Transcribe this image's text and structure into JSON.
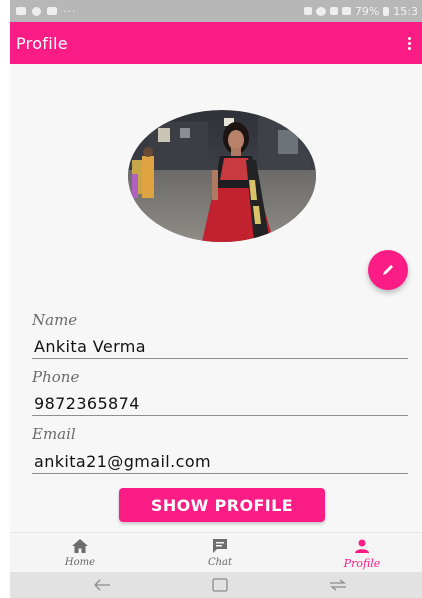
{
  "status_bar": {
    "more_dots": "···",
    "battery_percent": "79%",
    "time": "15:3"
  },
  "app_bar": {
    "title": "Profile",
    "menu_icon": "more-vert-icon"
  },
  "profile": {
    "avatar_icon": "profile-photo",
    "edit_icon": "pencil-icon",
    "name_label": "Name",
    "name_value": "Ankita Verma",
    "phone_label": "Phone",
    "phone_value": "9872365874",
    "email_label": "Email",
    "email_value": "ankita21@gmail.com",
    "show_profile_label": "SHOW PROFILE"
  },
  "bottom_nav": {
    "items": [
      {
        "label": "Home",
        "icon": "home-icon",
        "active": false
      },
      {
        "label": "Chat",
        "icon": "chat-icon",
        "active": false
      },
      {
        "label": "Profile",
        "icon": "person-icon",
        "active": true
      }
    ]
  },
  "colors": {
    "accent": "#fb1c86",
    "background": "#f7f7f7",
    "status_bar": "#b7b7b7"
  }
}
